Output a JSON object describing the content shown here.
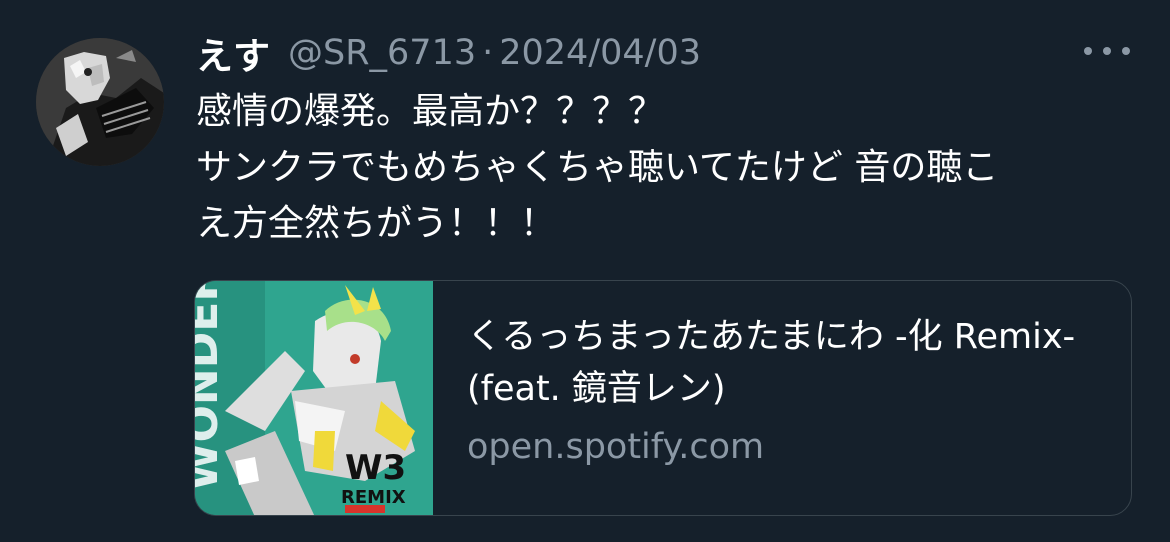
{
  "tweet": {
    "display_name": "えす",
    "handle": "@SR_6713",
    "separator": "·",
    "date": "2024/04/03",
    "text": "感情の爆発。最高か？？？？\nサンクラでもめちゃくちゃ聴いてたけど 音の聴こ\nえ方全然ちがう！！！",
    "more_icon": "more-horizontal-icon"
  },
  "card": {
    "title": "くるっちまったあたまにわ -化 Remix- (feat. 鏡音レン)",
    "domain": "open.spotify.com",
    "thumbnail_text_1": "W3",
    "thumbnail_text_2": "REMIX"
  },
  "colors": {
    "background": "#15202b",
    "text_primary": "#ffffff",
    "text_secondary": "#8b98a5",
    "card_border": "#38444d",
    "thumb_teal": "#2fa58f"
  }
}
